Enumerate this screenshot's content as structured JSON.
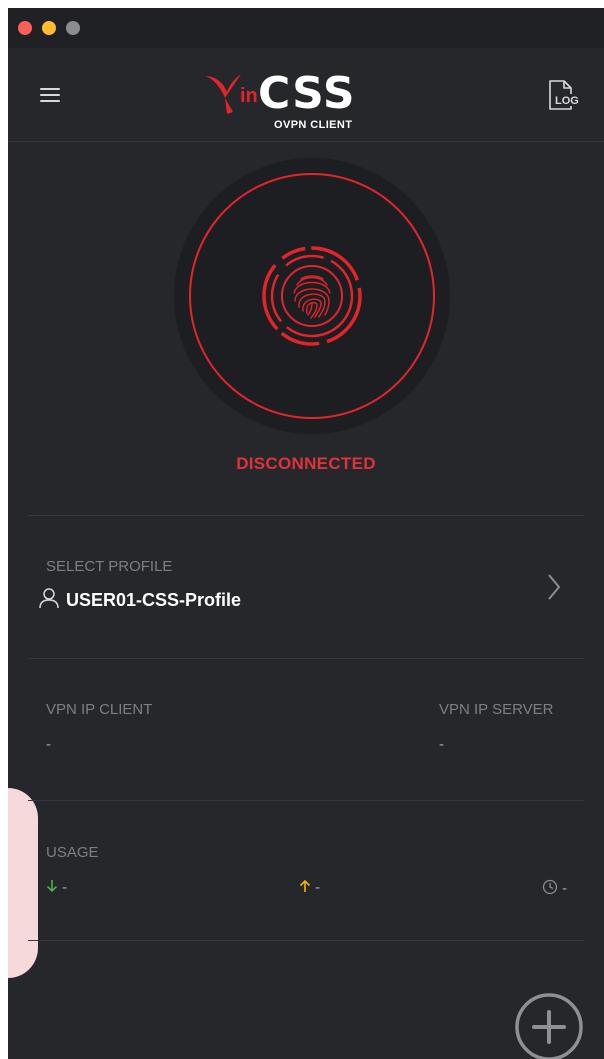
{
  "colors": {
    "background": "#25272b",
    "accent": "#e3242b",
    "download": "#4caf50",
    "upload": "#f5b400"
  },
  "window": {
    "traffic_lights": [
      "close",
      "minimize",
      "zoom"
    ]
  },
  "header": {
    "menu_icon": "hamburger-menu-icon",
    "logo": {
      "mark": "in",
      "name": "CSS",
      "subtitle": "OVPN CLIENT"
    },
    "log_button": {
      "icon": "log-file-icon",
      "label": "LOG"
    }
  },
  "connection": {
    "button_icon": "fingerprint-icon",
    "status": "DISCONNECTED"
  },
  "profile": {
    "label": "SELECT PROFILE",
    "icon": "user-icon",
    "name": "USER01-CSS-Profile",
    "chevron_icon": "chevron-right-icon"
  },
  "ip": {
    "client_label": "VPN IP CLIENT",
    "client_value": "-",
    "server_label": "VPN IP SERVER",
    "server_value": "-"
  },
  "usage": {
    "label": "USAGE",
    "download_icon": "arrow-down-icon",
    "download_value": "-",
    "upload_icon": "arrow-up-icon",
    "upload_value": "-",
    "time_icon": "clock-icon",
    "time_value": "-"
  },
  "actions": {
    "add_icon": "plus-circle-icon"
  }
}
